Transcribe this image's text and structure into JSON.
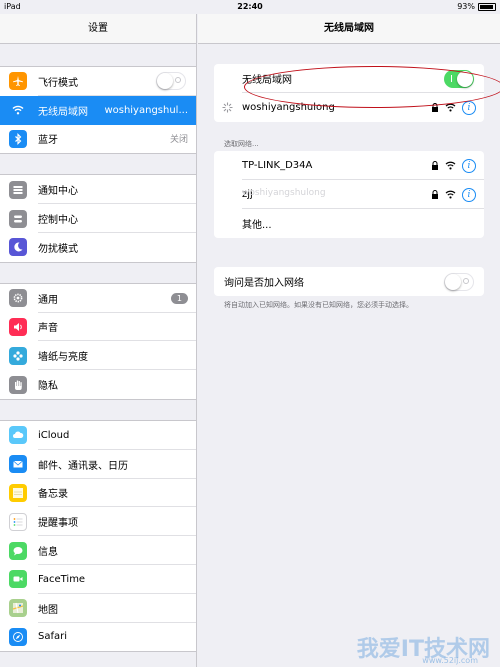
{
  "status": {
    "device": "iPad",
    "time": "22:40",
    "battery": "93%",
    "battery_level": 0.93
  },
  "left": {
    "title": "设置",
    "groups": [
      [
        {
          "label": "飞行模式",
          "icon": "airplane-icon",
          "color": "#ff9500",
          "toggle": "off"
        },
        {
          "label": "无线局域网",
          "value": "woshiyangshul...",
          "icon": "wifi-icon",
          "color": "#1a8cf4",
          "selected": true
        },
        {
          "label": "蓝牙",
          "value": "关闭",
          "icon": "bluetooth-icon",
          "color": "#1a8cf4"
        }
      ],
      [
        {
          "label": "通知中心",
          "icon": "notification-center-icon",
          "color": "#8e8e93"
        },
        {
          "label": "控制中心",
          "icon": "control-center-icon",
          "color": "#8e8e93"
        },
        {
          "label": "勿扰模式",
          "icon": "moon-icon",
          "color": "#5856d6"
        }
      ],
      [
        {
          "label": "通用",
          "icon": "gear-icon",
          "color": "#8e8e93",
          "badge": "1"
        },
        {
          "label": "声音",
          "icon": "speaker-icon",
          "color": "#ff2d55"
        },
        {
          "label": "墙纸与亮度",
          "icon": "flower-icon",
          "color": "#34aadc"
        },
        {
          "label": "隐私",
          "icon": "hand-icon",
          "color": "#8e8e93"
        }
      ],
      [
        {
          "label": "iCloud",
          "icon": "cloud-icon",
          "color": "#5ac8fa"
        },
        {
          "label": "邮件、通讯录、日历",
          "icon": "mail-icon",
          "color": "#1a8cf4"
        },
        {
          "label": "备忘录",
          "icon": "notes-icon",
          "color": "#ffcc00"
        },
        {
          "label": "提醒事项",
          "icon": "reminders-icon",
          "color": "#ffffff"
        },
        {
          "label": "信息",
          "icon": "messages-icon",
          "color": "#4cd964"
        },
        {
          "label": "FaceTime",
          "icon": "facetime-icon",
          "color": "#4cd964"
        },
        {
          "label": "地图",
          "icon": "maps-icon",
          "color": "#a8d08d"
        },
        {
          "label": "Safari",
          "icon": "safari-icon",
          "color": "#1a8cf4"
        }
      ]
    ]
  },
  "right": {
    "title": "无线局域网",
    "wifi_label": "无线局域网",
    "wifi_toggle": "on",
    "current_network": "woshiyangshulong",
    "choose_label": "选取网络...",
    "networks": [
      {
        "name": "TP-LINK_D34A"
      },
      {
        "name": "zjj"
      },
      {
        "name": "其他..."
      }
    ],
    "ghost_text": "woshiyangshulong",
    "ask_label": "询问是否加入网络",
    "ask_toggle": "off",
    "footer_note": "将自动加入已知网络。如果没有已知网络，您必须手动选择。"
  },
  "watermark": {
    "text": "我爱IT技术网",
    "url": "www.52ij.com"
  },
  "colors": {
    "accent": "#1a8cf4",
    "on": "#4cd964",
    "annotation": "#c0101a"
  }
}
